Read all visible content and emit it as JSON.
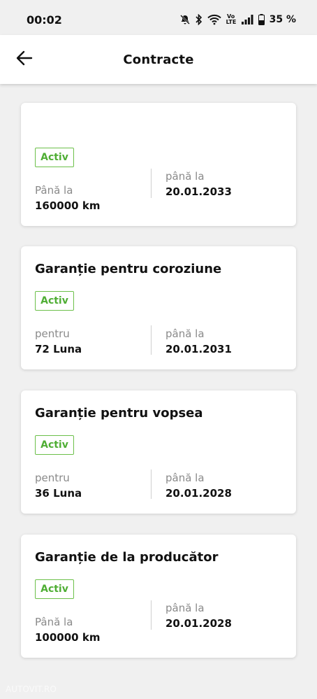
{
  "status_bar": {
    "time": "00:02",
    "volte": "Vo LTE",
    "battery": "35 %"
  },
  "header": {
    "title": "Contracte"
  },
  "colors": {
    "active_badge": "#4fae34"
  },
  "contracts": [
    {
      "title": "",
      "status": "Activ",
      "left_label": "Până la",
      "left_value": "160000 km",
      "right_label": "până la",
      "right_value": "20.01.2033"
    },
    {
      "title": "Garanție pentru coroziune",
      "status": "Activ",
      "left_label": "pentru",
      "left_value": "72 Luna",
      "right_label": "până la",
      "right_value": "20.01.2031"
    },
    {
      "title": "Garanție pentru vopsea",
      "status": "Activ",
      "left_label": "pentru",
      "left_value": "36 Luna",
      "right_label": "până la",
      "right_value": "20.01.2028"
    },
    {
      "title": "Garanție de la producător",
      "status": "Activ",
      "left_label": "Până la",
      "left_value": "100000 km",
      "right_label": "până la",
      "right_value": "20.01.2028"
    }
  ],
  "watermark": "AUTOVIT.RO"
}
